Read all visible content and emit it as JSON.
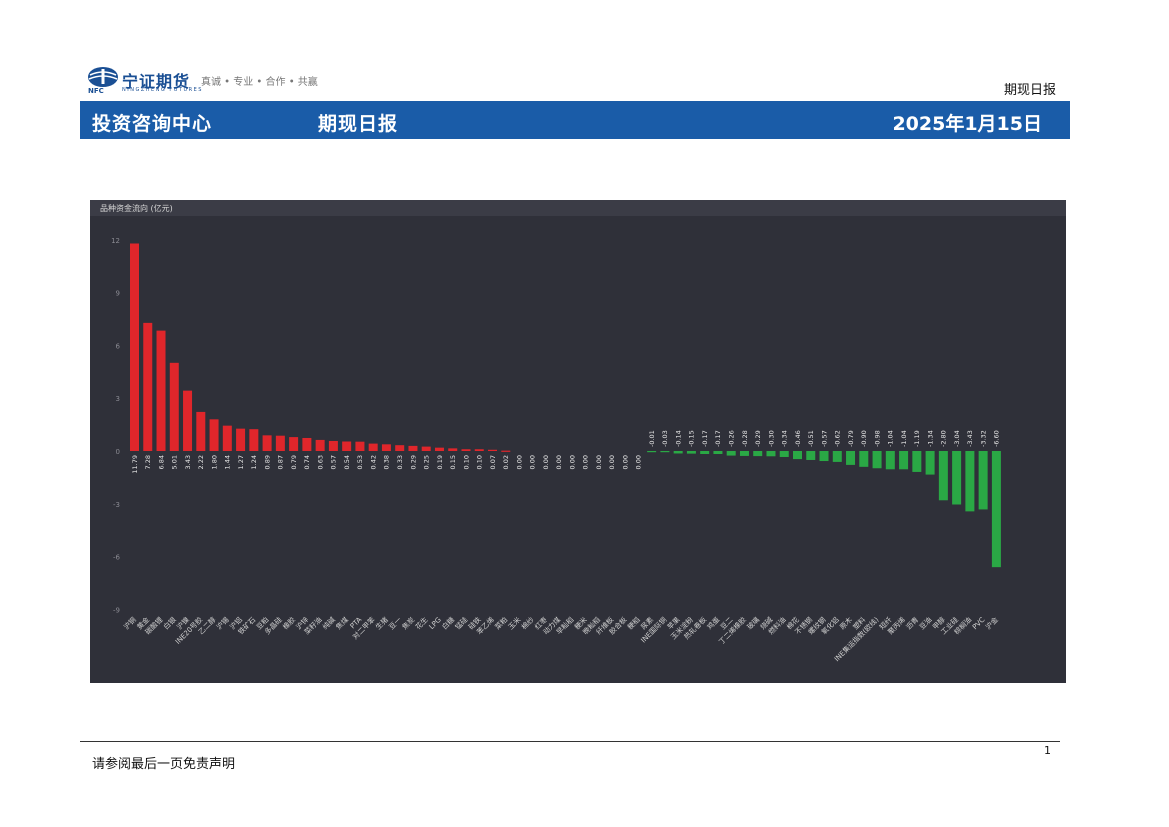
{
  "header": {
    "logo_name": "宁证期货",
    "logo_english": "NINGZHENG FUTURES",
    "logo_abbr": "NFC",
    "logo_slogan": "真诚 • 专业 • 合作 • 共赢",
    "report_type": "期现日报",
    "banner_left": "投资咨询中心",
    "banner_center": "期现日报",
    "banner_date": "2025年1月15日",
    "brand_color": "#1a5ca8"
  },
  "chart_data": {
    "type": "bar",
    "title": "品种资金流向 (亿元)",
    "ylim": [
      -9,
      13
    ],
    "yticks": [
      -9,
      -6,
      -3,
      0,
      3,
      6,
      9,
      12
    ],
    "grid": false,
    "positive_color": "#e0262b",
    "negative_color": "#2aa845",
    "background": "#2f3039",
    "categories": [
      "沪铜",
      "黄金",
      "碳酸锂",
      "白银",
      "沪镍",
      "INE20号胶",
      "乙二醇",
      "沪锡",
      "沪铝",
      "铁矿石",
      "豆粕",
      "多晶硅",
      "橡胶",
      "沪锌",
      "菜籽油",
      "纯碱",
      "焦煤",
      "PTA",
      "对二甲苯",
      "生猪",
      "豆一",
      "焦炭",
      "花生",
      "LPG",
      "白糖",
      "锰硅",
      "硅铁",
      "苯乙烯",
      "菜粕",
      "玉米",
      "棉纱",
      "红枣",
      "动力煤",
      "早籼稻",
      "粳米",
      "晚籼稻",
      "纤维板",
      "胶合板",
      "粳稻",
      "尿素",
      "INE国际铜",
      "苹果",
      "玉米淀粉",
      "热轧卷板",
      "鸡蛋",
      "豆二",
      "丁二烯橡胶",
      "玻璃",
      "烧碱",
      "燃料油",
      "棉花",
      "不锈钢",
      "螺纹钢",
      "氧化铝",
      "原木",
      "塑料",
      "INE集运指数(欧线)",
      "短纤",
      "聚丙烯",
      "沥青",
      "豆油",
      "甲醇",
      "工业硅",
      "棕榈油",
      "PVC",
      "沪金"
    ],
    "values": [
      11.79,
      7.28,
      6.84,
      5.01,
      3.43,
      2.22,
      1.8,
      1.44,
      1.27,
      1.24,
      0.89,
      0.87,
      0.79,
      0.74,
      0.63,
      0.57,
      0.54,
      0.53,
      0.42,
      0.38,
      0.33,
      0.29,
      0.25,
      0.19,
      0.15,
      0.1,
      0.1,
      0.07,
      0.02,
      0.0,
      0.0,
      0.0,
      0.0,
      0.0,
      0.0,
      0.0,
      0.0,
      0.0,
      0.0,
      -0.01,
      -0.03,
      -0.14,
      -0.15,
      -0.17,
      -0.17,
      -0.26,
      -0.28,
      -0.29,
      -0.3,
      -0.34,
      -0.46,
      -0.51,
      -0.57,
      -0.62,
      -0.79,
      -0.9,
      -0.98,
      -1.04,
      -1.04,
      -1.19,
      -1.34,
      -2.8,
      -3.04,
      -3.43,
      -3.32,
      -6.6
    ]
  },
  "footer": {
    "disclaimer": "请参阅最后一页免责声明",
    "page_number": "1"
  }
}
